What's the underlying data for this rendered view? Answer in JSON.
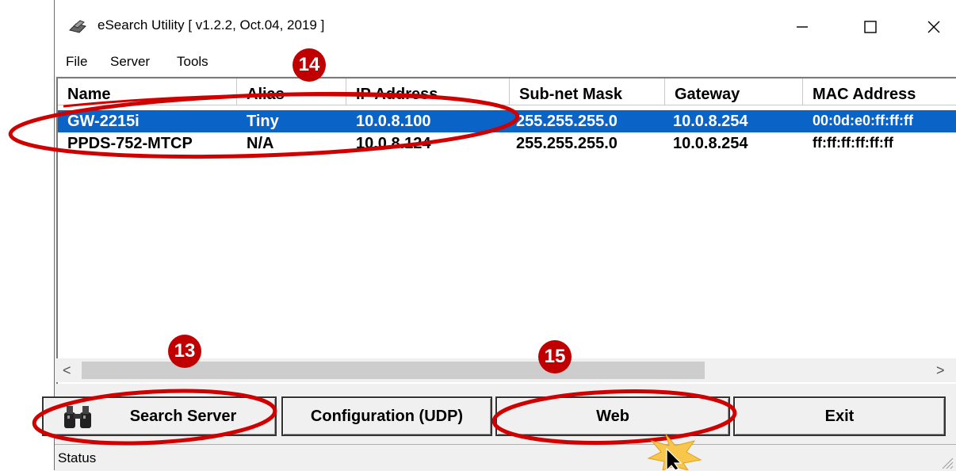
{
  "window": {
    "title": "eSearch Utility [ v1.2.2, Oct.04, 2019 ]",
    "controls": {
      "minimize": "—",
      "maximize": "☐",
      "close": "✕"
    }
  },
  "menu": {
    "file": "File",
    "server": "Server",
    "tools": "Tools"
  },
  "list": {
    "columns": [
      "Name",
      "Alias",
      "IP Address",
      "Sub-net Mask",
      "Gateway",
      "MAC Address"
    ],
    "rows": [
      {
        "name": "GW-2215i",
        "alias": "Tiny",
        "ip": "10.0.8.100",
        "mask": "255.255.255.0",
        "gateway": "10.0.8.254",
        "mac": "00:0d:e0:ff:ff:ff",
        "selected": true
      },
      {
        "name": "PPDS-752-MTCP",
        "alias": "N/A",
        "ip": "10.0.8.124",
        "mask": "255.255.255.0",
        "gateway": "10.0.8.254",
        "mac": "ff:ff:ff:ff:ff:ff",
        "selected": false
      }
    ]
  },
  "scrollbar": {
    "left_arrow": "<",
    "right_arrow": ">"
  },
  "buttons": {
    "search": "Search Server",
    "config": "Configuration (UDP)",
    "web": "Web",
    "exit": "Exit"
  },
  "status": {
    "text": "Status"
  },
  "annotations": {
    "step_13": "13",
    "step_14": "14",
    "step_15": "15",
    "color": "#c00000"
  },
  "colors": {
    "selection": "#0a64c8",
    "annotation_red": "#d00000",
    "cursor_burst": "#f7c64a"
  }
}
